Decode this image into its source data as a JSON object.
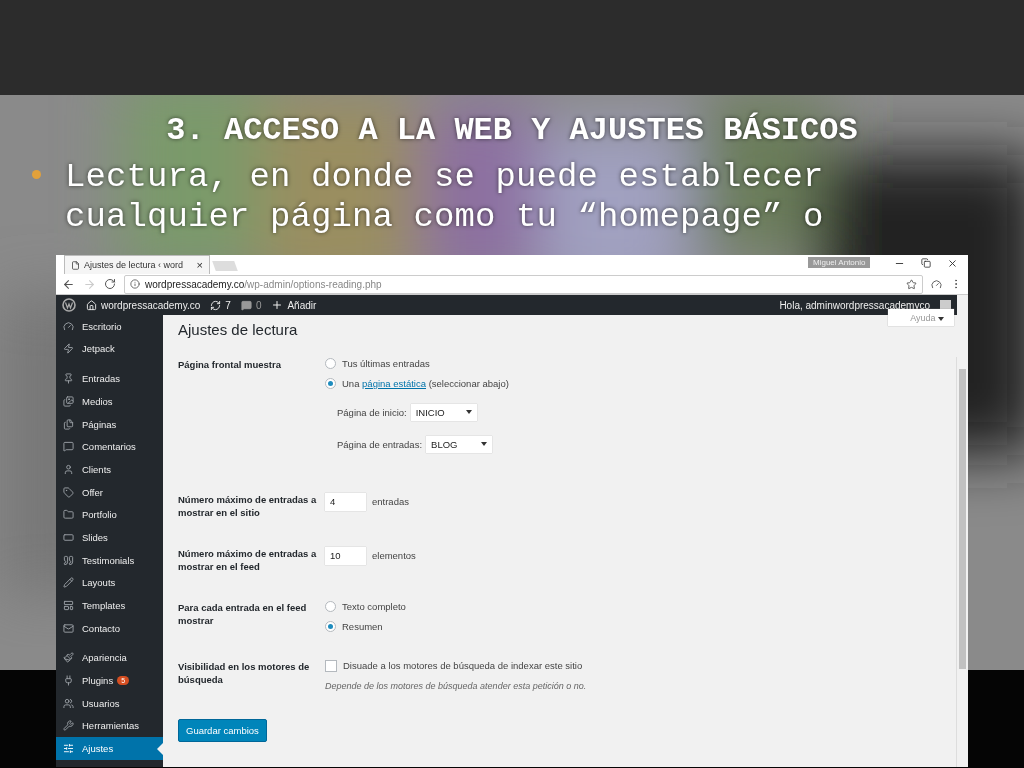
{
  "slide": {
    "title": "3. ACCESO A LA WEB Y AJUSTES BÁSICOS",
    "bullet_lines": [
      "Lectura, en donde se puede establecer",
      "cualquier página como tu “homepage” o"
    ]
  },
  "browser": {
    "tab": {
      "title": "Ajustes de lectura ‹ word",
      "close": "×"
    },
    "profile": "Miguel Antonio",
    "url_domain": "wordpressacademy.co",
    "url_path": "/wp-admin/options-reading.php"
  },
  "admin_bar": {
    "site": "wordpressacademy.co",
    "updates": "7",
    "comments": "0",
    "new": "Añadir",
    "greeting": "Hola, adminwordpressacademyco"
  },
  "sidebar": {
    "groups": [
      [
        {
          "label": "Escritorio",
          "selected": false
        },
        {
          "label": "Jetpack",
          "selected": false
        }
      ],
      [
        {
          "label": "Entradas",
          "selected": false
        },
        {
          "label": "Medios",
          "selected": false
        },
        {
          "label": "Páginas",
          "selected": false
        },
        {
          "label": "Comentarios",
          "selected": false
        },
        {
          "label": "Clients",
          "selected": false
        },
        {
          "label": "Offer",
          "selected": false
        },
        {
          "label": "Portfolio",
          "selected": false
        },
        {
          "label": "Slides",
          "selected": false
        },
        {
          "label": "Testimonials",
          "selected": false
        },
        {
          "label": "Layouts",
          "selected": false
        },
        {
          "label": "Templates",
          "selected": false
        },
        {
          "label": "Contacto",
          "selected": false
        }
      ],
      [
        {
          "label": "Apariencia",
          "selected": false
        },
        {
          "label": "Plugins",
          "selected": false,
          "badge": "5"
        },
        {
          "label": "Usuarios",
          "selected": false
        },
        {
          "label": "Herramientas",
          "selected": false
        },
        {
          "label": "Ajustes",
          "selected": true
        }
      ]
    ]
  },
  "help": "Ayuda",
  "page_title": "Ajustes de lectura",
  "rows": [
    {
      "kind": "radio",
      "label": "Página frontal muestra",
      "options": [
        {
          "text": "Tus últimas entradas",
          "selected": false
        },
        {
          "before": "Una ",
          "link": "página estática",
          "after": " (seleccionar abajo)",
          "selected": true
        }
      ],
      "selects": [
        {
          "label": "Página de inicio:",
          "value": "INICIO"
        },
        {
          "label": "Página de entradas:",
          "value": "BLOG"
        }
      ]
    },
    {
      "kind": "number",
      "label": "Número máximo de entradas a mostrar en el sitio",
      "value": "4",
      "unit": "entradas"
    },
    {
      "kind": "number",
      "label": "Número máximo de entradas a mostrar en el feed",
      "value": "10",
      "unit": "elementos"
    },
    {
      "kind": "radio",
      "label": "Para cada entrada en el feed mostrar",
      "options": [
        {
          "text": "Texto completo",
          "selected": false
        },
        {
          "text": "Resumen",
          "selected": true
        }
      ]
    },
    {
      "kind": "checkbox",
      "label": "Visibilidad en los motores de búsqueda",
      "text": "Disuade a los motores de búsqueda de indexar este sitio",
      "checked": false,
      "description": "Depende de los motores de búsqueda atender esta petición o no."
    }
  ],
  "save_button": "Guardar cambios"
}
